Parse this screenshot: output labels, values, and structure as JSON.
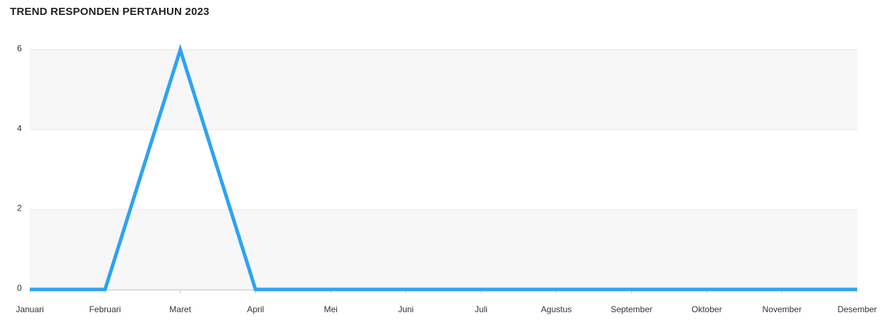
{
  "chart_data": {
    "type": "line",
    "title": "TREND RESPONDEN PERTAHUN 2023",
    "xlabel": "",
    "ylabel": "",
    "categories": [
      "Januari",
      "Februari",
      "Maret",
      "April",
      "Mei",
      "Juni",
      "Juli",
      "Agustus",
      "September",
      "Oktober",
      "November",
      "Desember"
    ],
    "series": [
      {
        "values": [
          0,
          0,
          6,
          0,
          0,
          0,
          0,
          0,
          0,
          0,
          0,
          0
        ],
        "color": "#2ea3f2"
      }
    ],
    "yticks": [
      0,
      2,
      4,
      6
    ],
    "ylim": [
      0,
      6
    ],
    "grid": true,
    "band_color": "#f7f7f8"
  }
}
